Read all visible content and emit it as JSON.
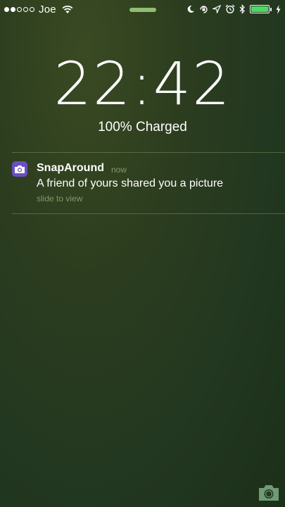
{
  "status_bar": {
    "signal_filled": 2,
    "signal_total": 5,
    "carrier": "Joe",
    "battery_level": 1.0,
    "icons": [
      "wifi-icon",
      "moon-icon",
      "rotation-lock-icon",
      "location-arrow-icon",
      "alarm-icon",
      "bluetooth-icon",
      "battery-icon",
      "charging-bolt-icon"
    ]
  },
  "lock_screen": {
    "time": "22:42",
    "charge_status": "100% Charged"
  },
  "notification": {
    "app_name": "SnapAround",
    "time": "now",
    "message": "A friend of yours shared you a picture",
    "action_hint": "slide to view",
    "app_icon": "camera-icon",
    "app_icon_color": "#6b4fbf"
  },
  "colors": {
    "grabber": "#8fbf72",
    "battery_fill": "#4cd964",
    "muted_text": "#7f9a6a"
  },
  "camera_shortcut": {
    "icon": "camera-icon"
  }
}
